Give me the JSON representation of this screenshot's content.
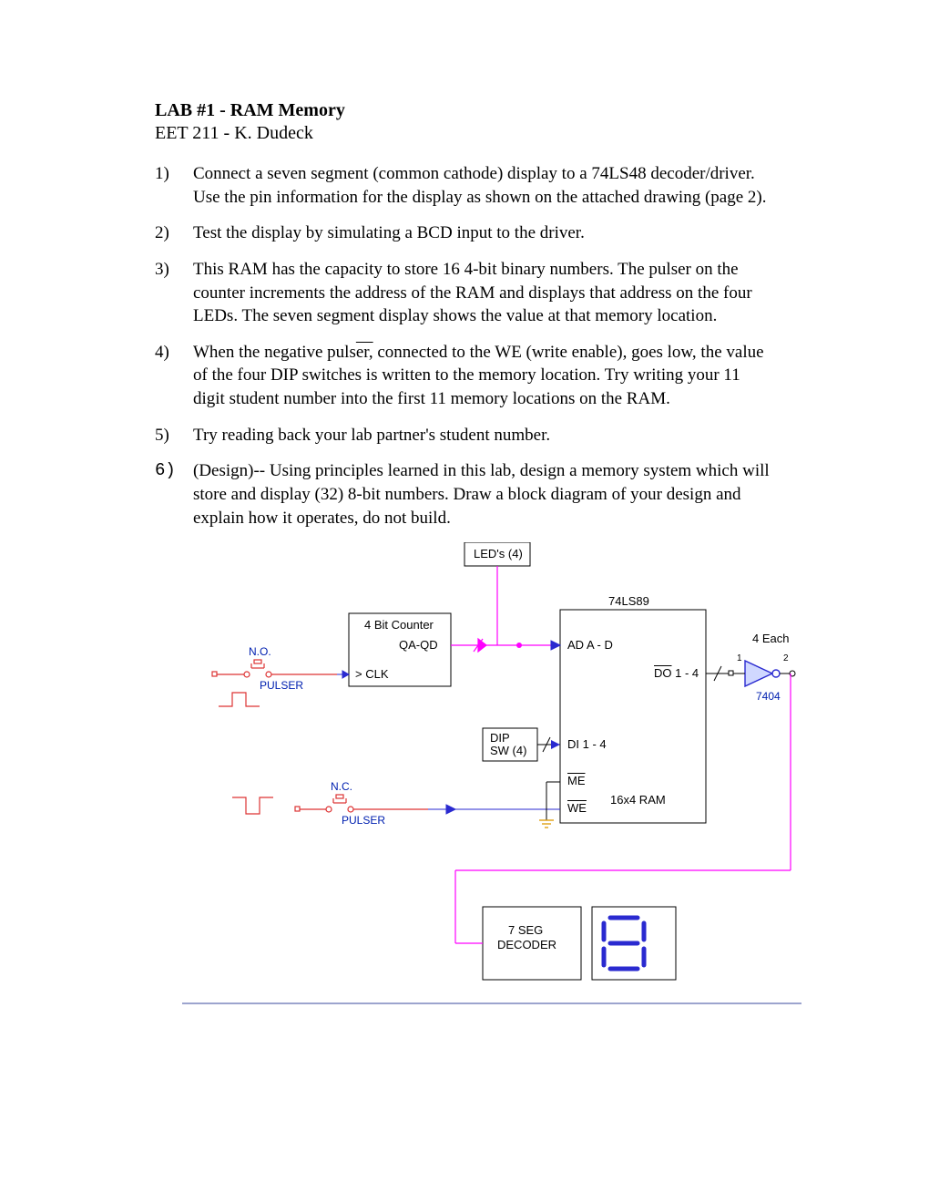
{
  "title": "LAB #1  - RAM Memory",
  "subtitle": "EET 211 -  K. Dudeck",
  "steps": [
    {
      "n": "1)",
      "text": "Connect a seven segment (common cathode) display to a 74LS48 decoder/driver.  Use the pin information for the display as shown on the attached drawing (page 2)."
    },
    {
      "n": "2)",
      "text": "Test the display by simulating a BCD input to the driver."
    },
    {
      "n": "3)",
      "text": "This RAM has the capacity to store 16 4-bit binary numbers.  The pulser on the counter increments the address of the RAM and displays that address on the four LEDs. The seven segment display shows the value at that memory location."
    },
    {
      "n": "4)",
      "html": "When the negative puls<span class=\"overbar\">er,</span> connected to the WE (write enable), goes low, the value of the four DIP switches is written to the memory location.  Try writing your 11 digit student number into the first 11 memory locations on the RAM."
    },
    {
      "n": "5)",
      "text": "Try reading back your lab partner's student number."
    },
    {
      "n": "6)",
      "mono": true,
      "text": "(Design)-- Using principles learned in this lab, design a memory system which will store and display (32) 8-bit numbers.  Draw a block diagram of your design and explain how it operates, do not build."
    }
  ],
  "diagram": {
    "leds": "LED's (4)",
    "counter_title": "4 Bit Counter",
    "qa_qd": "QA-QD",
    "clk": "> CLK",
    "pulser_no": "N.O.",
    "pulser": "PULSER",
    "pulser_nc": "N.C.",
    "dip": "DIP",
    "dip2": "SW (4)",
    "ram_title": "74LS89",
    "ad": "AD A - D",
    "do": "DO 1 - 4",
    "do_prefix": "DO",
    "di": "DI 1 - 4",
    "me": "ME",
    "we": "WE",
    "ram_label": "16x4 RAM",
    "four_each": "4 Each",
    "inv_chip": "7404",
    "inv_pin1": "1",
    "inv_pin2": "2",
    "seg_decoder1": "7 SEG",
    "seg_decoder2": "DECODER"
  }
}
